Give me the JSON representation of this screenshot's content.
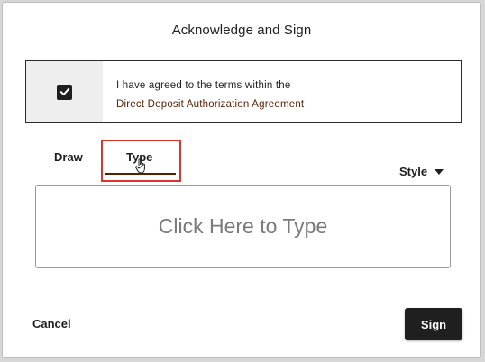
{
  "dialog": {
    "title": "Acknowledge and Sign"
  },
  "acknowledgement": {
    "checked": true,
    "text": "I have agreed to the terms within the",
    "link_label": "Direct Deposit Authorization Agreement"
  },
  "tabs": [
    {
      "label": "Draw",
      "active": false
    },
    {
      "label": "Type",
      "active": true
    }
  ],
  "style_menu": {
    "label": "Style",
    "icon": "caret-down-icon"
  },
  "type_area": {
    "placeholder": "Click Here to Type"
  },
  "actions": {
    "cancel_label": "Cancel",
    "sign_label": "Sign"
  },
  "colors": {
    "accent": "#5a1e00",
    "button_dark": "#1f1f1f",
    "highlight": "#e0342b"
  }
}
